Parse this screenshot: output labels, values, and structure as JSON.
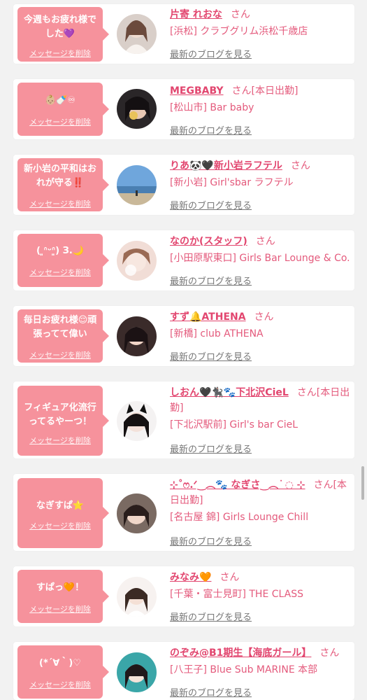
{
  "delete_label": "メッセージを削除",
  "blog_label": "最新のブログを見る",
  "san_label": "さん",
  "items": [
    {
      "message": "今週もお疲れ様でした💜",
      "name": "片寄 れおな",
      "suffix": "さん",
      "shop": "[浜松] クラブグリム浜松千歳店"
    },
    {
      "message": "👶🏼🍼♾",
      "name": "MEGBABY",
      "suffix": "さん[本日出勤]",
      "shop": "[松山市] Bar baby"
    },
    {
      "message": "新小岩の平和はおれが守る‼️",
      "name": "りあ🐼🖤新小岩ラフテル",
      "suffix": "さん",
      "shop": "[新小岩] Girl'sbar ラフテル"
    },
    {
      "message": "( ͈ᐢᵕᐢ͈) З.🌙",
      "name": "なのか(スタッフ)",
      "suffix": "さん",
      "shop": "[小田原駅東口] Girls Bar Lounge & Co."
    },
    {
      "message": "毎日お疲れ様😌頑張ってて偉い",
      "name": "すず🔔ATHENA",
      "suffix": "さん",
      "shop": "[新橋] club ATHENA"
    },
    {
      "message": "フィギュア化流行ってるやーつ！",
      "name": "しおん🖤🐈‍⬛🐾下北沢CieL",
      "suffix": "さん[本日出勤]",
      "shop": "[下北沢駅前] Girl's bar CieL"
    },
    {
      "message": "なぎすぱ⭐️",
      "name": "⊹˚ෆ.ᐟ‿︵🐾 なぎさ‿︵ ͘ ◌ ⊹",
      "suffix": "さん[本日出勤]",
      "shop": "[名古屋 錦] Girls Lounge Chill"
    },
    {
      "message": "すぱっ🧡！",
      "name": "みなみ🧡",
      "suffix": "さん",
      "shop": "[千葉・富士見町] THE CLASS"
    },
    {
      "message": "(*´∀｀)♡",
      "name": "のぞみ@B1期生【海底ガール】",
      "suffix": "さん",
      "shop": "[八王子] Blue Sub MARINE 本部"
    }
  ]
}
